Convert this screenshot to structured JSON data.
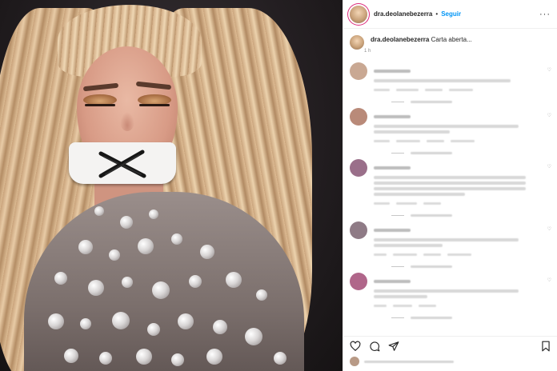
{
  "post": {
    "username": "dra.deolanebezerra",
    "separator": "•",
    "follow_label": "Seguir",
    "more_icon": "more-horizontal-icon",
    "caption_username": "dra.deolanebezerra",
    "caption_text": "Carta aberta...",
    "caption_time": "1 h"
  },
  "comments": [
    {
      "avatar_color": "#c9a893",
      "lines": [
        0.9
      ],
      "meta": [
        20,
        28,
        22,
        30
      ]
    },
    {
      "avatar_color": "#b98a79",
      "lines": [
        0.95,
        0.5
      ],
      "meta": [
        20,
        30,
        22,
        30
      ]
    },
    {
      "avatar_color": "#9a6f8a",
      "lines": [
        1.0,
        1.0,
        1.0,
        0.6
      ],
      "meta": [
        20,
        26,
        22
      ]
    },
    {
      "avatar_color": "#8f7b86",
      "lines": [
        0.95,
        0.45
      ],
      "meta": [
        16,
        30,
        22,
        30
      ]
    },
    {
      "avatar_color": "#b0668a",
      "lines": [
        0.95,
        0.35
      ],
      "meta": [
        16,
        24,
        22
      ]
    }
  ],
  "actions": {
    "like_icon": "heart-icon",
    "comment_icon": "comment-icon",
    "share_icon": "share-icon",
    "save_icon": "bookmark-icon"
  }
}
